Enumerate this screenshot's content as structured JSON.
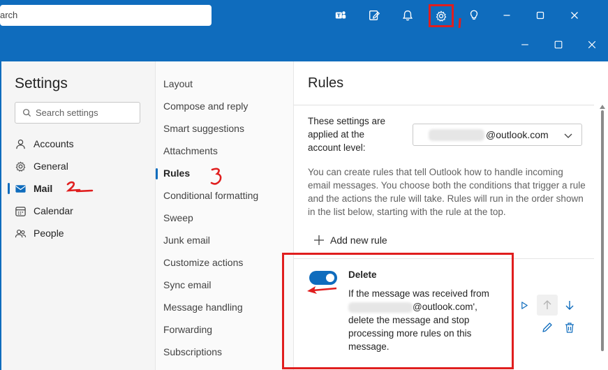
{
  "appbar": {
    "search_text": "arch"
  },
  "dialog": {
    "settings_title": "Settings",
    "search_placeholder": "Search settings",
    "nav1": [
      {
        "label": "Accounts",
        "icon": "person-icon"
      },
      {
        "label": "General",
        "icon": "gear-icon"
      },
      {
        "label": "Mail",
        "icon": "mail-icon",
        "selected": true
      },
      {
        "label": "Calendar",
        "icon": "calendar-icon"
      },
      {
        "label": "People",
        "icon": "people-icon"
      }
    ],
    "nav2": [
      {
        "label": "Layout"
      },
      {
        "label": "Compose and reply"
      },
      {
        "label": "Smart suggestions"
      },
      {
        "label": "Attachments"
      },
      {
        "label": "Rules",
        "selected": true
      },
      {
        "label": "Conditional formatting"
      },
      {
        "label": "Sweep"
      },
      {
        "label": "Junk email"
      },
      {
        "label": "Customize actions"
      },
      {
        "label": "Sync email"
      },
      {
        "label": "Message handling"
      },
      {
        "label": "Forwarding"
      },
      {
        "label": "Subscriptions"
      }
    ],
    "content": {
      "title": "Rules",
      "level_text": "These settings are applied at the account level:",
      "account_suffix": "@outlook.com",
      "description": "You can create rules that tell Outlook how to handle incoming email messages. You choose both the conditions that trigger a rule and the actions the rule will take. Rules will run in the order shown in the list below, starting with the rule at the top.",
      "add_rule_label": "Add new rule",
      "rule": {
        "name": "Delete",
        "enabled": true,
        "desc_line1": "If the message was received from",
        "desc_account": "@outlook.com',",
        "desc_line2": "delete the message and stop processing more rules on this message."
      }
    }
  },
  "annotations": {
    "step1": "1",
    "step2": "2",
    "step3": "3"
  },
  "colors": {
    "brand": "#0f6cbd",
    "annotation": "#e01e1e"
  }
}
